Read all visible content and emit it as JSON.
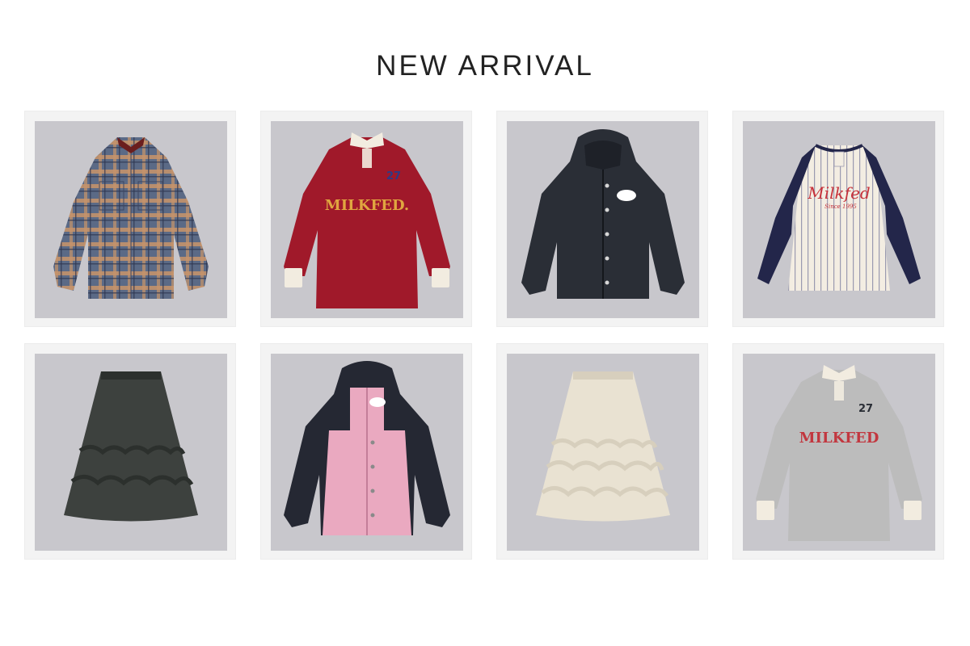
{
  "section_title": "NEW ARRIVAL",
  "products": [
    {
      "icon": "plaid-shirt-icon",
      "colors": {
        "main": "#5b6a86",
        "accent": "#c8946a",
        "collar": "#6b1e1e"
      }
    },
    {
      "icon": "rugby-shirt-icon",
      "colors": {
        "main": "#a0192a",
        "accent": "#f2ece0",
        "text": "#e0a640"
      },
      "print_text": "MILKFED.",
      "number": "27"
    },
    {
      "icon": "hooded-jacket-icon",
      "colors": {
        "main": "#2a2e36",
        "accent": "#ffffff"
      }
    },
    {
      "icon": "raglan-baseball-shirt-icon",
      "colors": {
        "main": "#f3ede2",
        "accent": "#23264a",
        "text": "#c7323b"
      },
      "print_text": "Milkfed",
      "print_sub": "Since 1995"
    },
    {
      "icon": "tiered-ruffle-skirt-icon",
      "colors": {
        "main": "#3d413e",
        "accent": "#2c302d"
      }
    },
    {
      "icon": "color-block-jacket-icon",
      "colors": {
        "main": "#252833",
        "accent": "#eaa9c0"
      }
    },
    {
      "icon": "tiered-ruffle-skirt-icon",
      "colors": {
        "main": "#e9e2d2",
        "accent": "#d7cfbd"
      }
    },
    {
      "icon": "rugby-shirt-icon",
      "colors": {
        "main": "#bcbcbc",
        "accent": "#f2ece0",
        "text": "#c2373f"
      },
      "print_text": "MILKFED",
      "number": "27"
    }
  ]
}
